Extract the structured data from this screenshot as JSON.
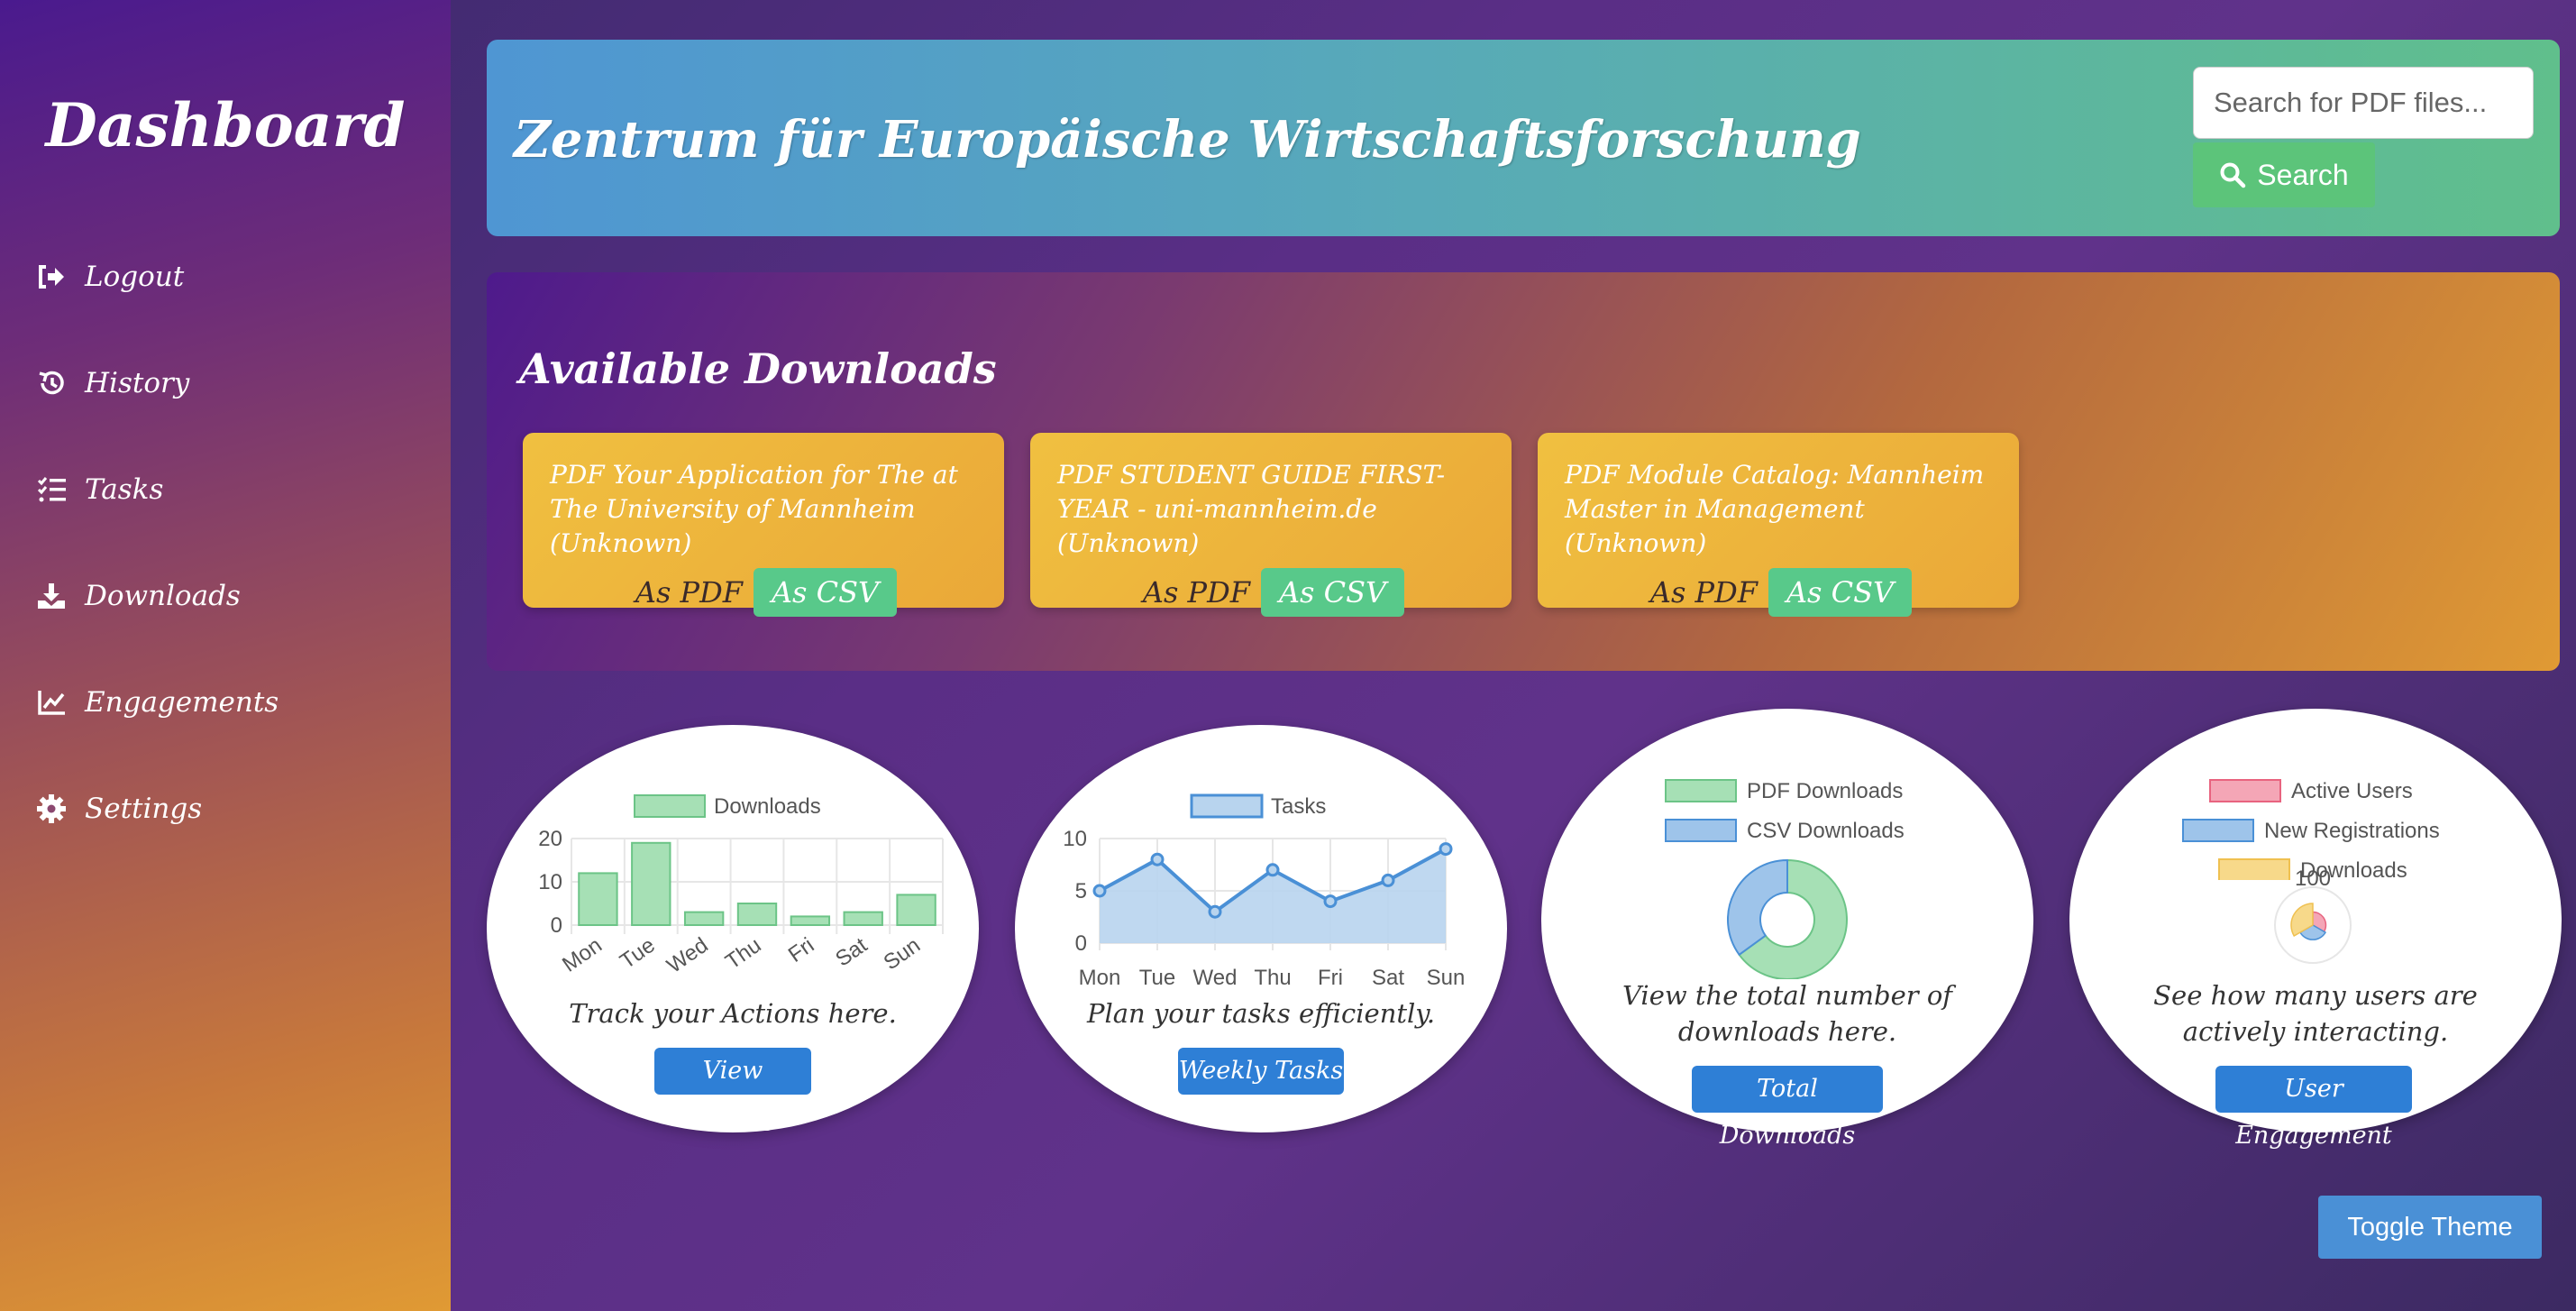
{
  "sidebar": {
    "brand": "Dashboard",
    "items": [
      {
        "label": "Logout",
        "icon": "logout-icon"
      },
      {
        "label": "History",
        "icon": "history-icon"
      },
      {
        "label": "Tasks",
        "icon": "tasks-icon"
      },
      {
        "label": "Downloads",
        "icon": "download-icon"
      },
      {
        "label": "Engagements",
        "icon": "chart-line-icon"
      },
      {
        "label": "Settings",
        "icon": "gear-icon"
      }
    ]
  },
  "header": {
    "title": "Zentrum für Europäische Wirtschaftsforschung",
    "search_placeholder": "Search for PDF files...",
    "search_button": "Search"
  },
  "downloads": {
    "title": "Available Downloads",
    "cards": [
      {
        "title": "PDF Your Application for The at The University of Mannheim (Unknown)",
        "pdf_label": "As PDF",
        "csv_label": "As CSV"
      },
      {
        "title": "PDF STUDENT GUIDE FIRST-YEAR - uni-mannheim.de (Unknown)",
        "pdf_label": "As PDF",
        "csv_label": "As CSV"
      },
      {
        "title": "PDF Module Catalog: Mannheim Master in Management (Unknown)",
        "pdf_label": "As PDF",
        "csv_label": "As CSV"
      }
    ]
  },
  "widgets": {
    "history": {
      "description": "Track your Actions here.",
      "button": "View History"
    },
    "tasks": {
      "description": "Plan your tasks efficiently.",
      "button": "Weekly Tasks"
    },
    "downloads": {
      "description": "View the total number of downloads here.",
      "button": "Total Downloads"
    },
    "engagement": {
      "description": "See how many users are actively interacting.",
      "button": "User Engagement"
    }
  },
  "toggle_theme": "Toggle Theme",
  "colors": {
    "green": "#5cc47a",
    "blue": "#2e7fd6",
    "pink": "#f4a6b6",
    "yellow": "#f7d98a"
  },
  "chart_data": [
    {
      "type": "bar",
      "categories": [
        "Mon",
        "Tue",
        "Wed",
        "Thu",
        "Fri",
        "Sat",
        "Sun"
      ],
      "series": [
        {
          "name": "Downloads",
          "values": [
            12,
            19,
            3,
            5,
            2,
            3,
            7
          ]
        }
      ],
      "ylim": [
        0,
        20
      ],
      "yticks": [
        0,
        10,
        20
      ],
      "grid": true,
      "legend": "top"
    },
    {
      "type": "line",
      "categories": [
        "Mon",
        "Tue",
        "Wed",
        "Thu",
        "Fri",
        "Sat",
        "Sun"
      ],
      "series": [
        {
          "name": "Tasks",
          "values": [
            5,
            8,
            3,
            7,
            4,
            6,
            9
          ]
        }
      ],
      "ylim": [
        0,
        10
      ],
      "yticks": [
        0,
        5,
        10
      ],
      "grid": true,
      "legend": "top"
    },
    {
      "type": "pie",
      "labels": [
        "PDF Downloads",
        "CSV Downloads"
      ],
      "values": [
        65,
        35
      ],
      "legend": "top"
    },
    {
      "type": "pie",
      "labels": [
        "Active Users",
        "New Registrations",
        "Downloads"
      ],
      "values": [
        20,
        25,
        55
      ],
      "tick_label": "100",
      "legend": "top"
    }
  ]
}
